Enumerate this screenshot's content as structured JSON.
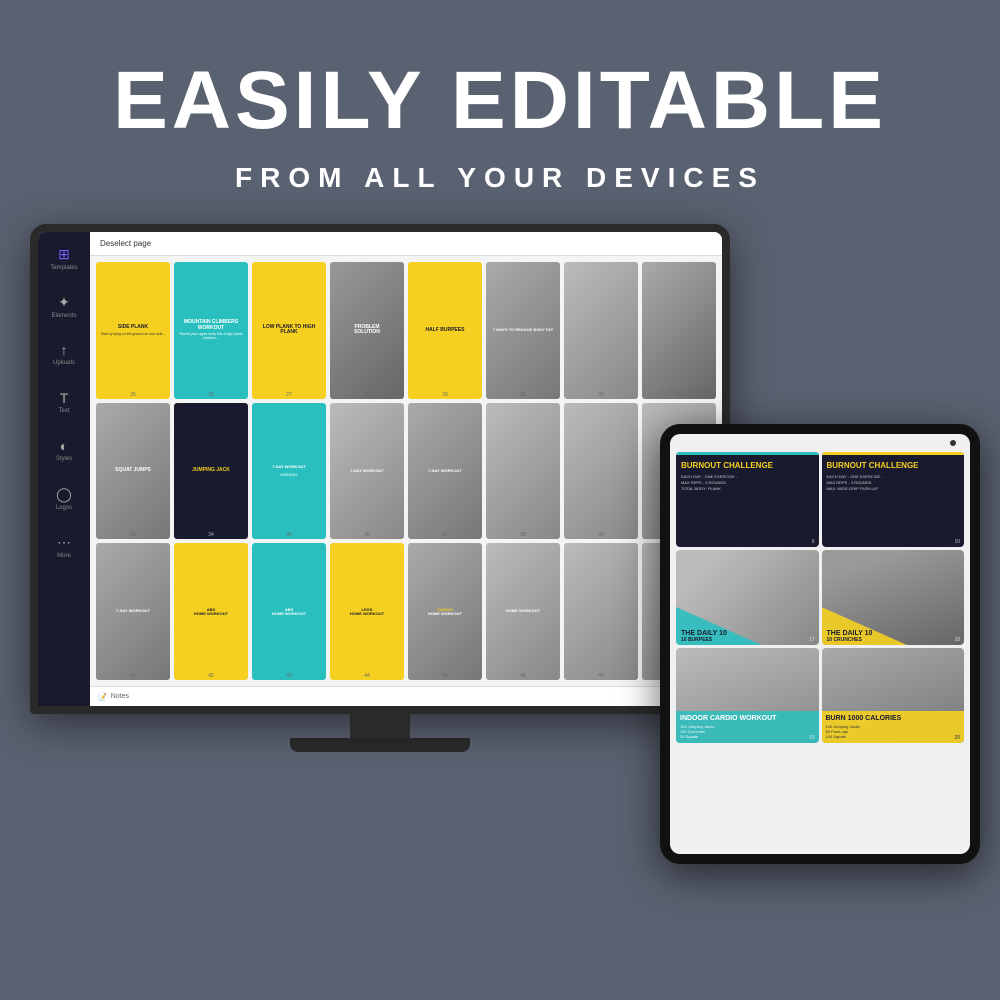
{
  "header": {
    "main_title": "EASILY EDITABLE",
    "sub_title": "FROM ALL YOUR DEVICES"
  },
  "monitor": {
    "topbar_text": "Deselect page",
    "footer_text": "Notes"
  },
  "templates": {
    "row1": [
      {
        "id": 25,
        "title": "SIDE PLANK",
        "type": "yellow"
      },
      {
        "id": 26,
        "title": "MOUNTAIN CLIMBERS WORKOUT",
        "type": "teal"
      },
      {
        "id": 27,
        "title": "LOW PLANK TO HIGH PLANK",
        "type": "yellow"
      },
      {
        "id": 28,
        "title": "PROBLEM / SOLUTION",
        "type": "photo"
      },
      {
        "id": 29,
        "title": "HALF BURPEES",
        "type": "yellow"
      },
      {
        "id": 30,
        "title": "7 WAYS TO REDUCE BODY FAT",
        "type": "photo"
      },
      {
        "id": 31,
        "title": "",
        "type": "photo"
      },
      {
        "id": 32,
        "title": "",
        "type": "photo"
      }
    ],
    "row2": [
      {
        "id": 33,
        "title": "SQUAT JUMPS",
        "type": "photo"
      },
      {
        "id": 34,
        "title": "JUMPING JACK",
        "type": "dark"
      },
      {
        "id": 35,
        "title": "7-DAY WORKOUT",
        "type": "teal"
      },
      {
        "id": 36,
        "title": "7-DAY WORKOUT",
        "type": "photo"
      },
      {
        "id": 37,
        "title": "7-DAY WORKOUT",
        "type": "photo"
      },
      {
        "id": 38,
        "title": "",
        "type": "photo"
      },
      {
        "id": 39,
        "title": "",
        "type": "photo"
      },
      {
        "id": 40,
        "title": "",
        "type": "photo"
      }
    ],
    "row3": [
      {
        "id": 41,
        "title": "7-DAY WORKOUT",
        "type": "photo"
      },
      {
        "id": 42,
        "title": "HOME WORKOUT",
        "type": "yellow"
      },
      {
        "id": 43,
        "title": "HOME WORKOUT",
        "type": "teal"
      },
      {
        "id": 44,
        "title": "HOME WORKOUT",
        "type": "yellow"
      },
      {
        "id": 45,
        "title": "HOME WORKOUT",
        "type": "photo"
      },
      {
        "id": 46,
        "title": "HOME WORKOUT",
        "type": "photo"
      },
      {
        "id": 47,
        "title": "",
        "type": "photo"
      },
      {
        "id": 48,
        "title": "",
        "type": "photo"
      }
    ]
  },
  "tablet": {
    "row1": [
      {
        "id": 9,
        "title": "BURNOUT CHALLENGE",
        "subtitle": "EACH DAY - ONE EXERCISE - MAX REPS - 3 ROUNDS TOTAL BODY: PLANK",
        "type": "burnout"
      },
      {
        "id": 10,
        "title": "BURNOUT CHALLENGE",
        "subtitle": "EACH DAY - ONE EXERCISE - MAX REPS - 3 ROUNDS MAX: WIDE-GRIP PUSH-UP",
        "type": "burnout"
      }
    ],
    "row2": [
      {
        "id": 17,
        "title": "THE DAILY 10",
        "subtitle": "10 BURPEES",
        "type": "daily"
      },
      {
        "id": 18,
        "title": "THE DAILY 10",
        "subtitle": "10 CRUNCHES",
        "type": "daily"
      }
    ],
    "row3": [
      {
        "id": 19,
        "title": "INDOOR CARDIO WORKOUT",
        "subtitle": "100 Jumping Jacks\n100 Crunches\n20 Squats",
        "type": "indoor"
      },
      {
        "id": 20,
        "title": "BURN 1000 CALORIES",
        "subtitle": "100 Jumping Jacks\n50 Push-ups\n100 Squats",
        "type": "burn"
      }
    ]
  },
  "sidebar": {
    "items": [
      {
        "icon": "⊞",
        "label": "Templates"
      },
      {
        "icon": "✦",
        "label": "Elements"
      },
      {
        "icon": "↑",
        "label": "Uploads"
      },
      {
        "icon": "T",
        "label": "Text"
      },
      {
        "icon": "◐",
        "label": "Styles"
      },
      {
        "icon": "◯",
        "label": "Logos"
      },
      {
        "icon": "⋯",
        "label": "More"
      }
    ]
  },
  "colors": {
    "bg": "#5a6170",
    "yellow_accent": "#f5d020",
    "teal_accent": "#2abfbf",
    "dark_navy": "#1a1a2e",
    "white": "#ffffff"
  }
}
